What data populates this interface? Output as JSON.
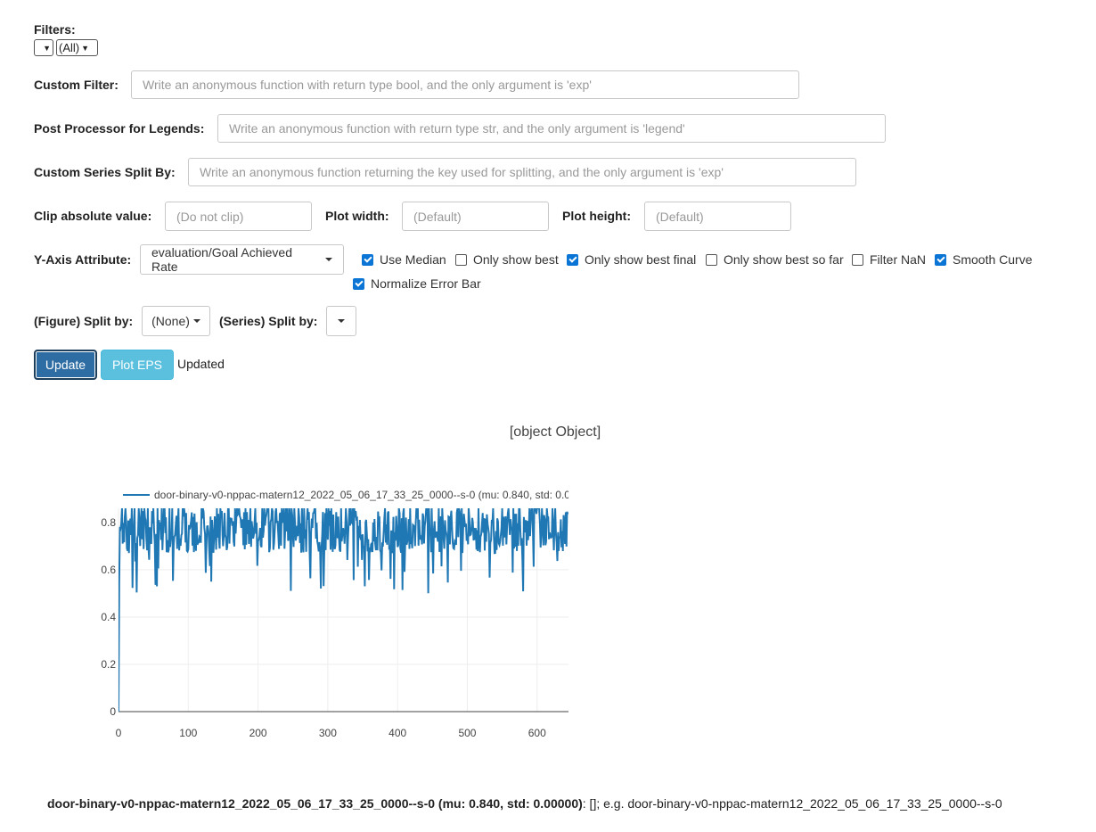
{
  "filters": {
    "label": "Filters:",
    "select1_value": "",
    "select2_value": "(All)"
  },
  "custom_filter": {
    "label": "Custom Filter:",
    "placeholder": "Write an anonymous function with return type bool, and the only argument is 'exp'"
  },
  "post_processor": {
    "label": "Post Processor for Legends:",
    "placeholder": "Write an anonymous function with return type str, and the only argument is 'legend'"
  },
  "series_split_fn": {
    "label": "Custom Series Split By:",
    "placeholder": "Write an anonymous function returning the key used for splitting, and the only argument is 'exp'"
  },
  "clip": {
    "label": "Clip absolute value:",
    "placeholder": "(Do not clip)"
  },
  "plot_width": {
    "label": "Plot width:",
    "placeholder": "(Default)"
  },
  "plot_height": {
    "label": "Plot height:",
    "placeholder": "(Default)"
  },
  "y_axis": {
    "label": "Y-Axis Attribute:",
    "value": "evaluation/Goal Achieved Rate"
  },
  "options": [
    {
      "label": "Use Median",
      "checked": true
    },
    {
      "label": "Only show best",
      "checked": false
    },
    {
      "label": "Only show best final",
      "checked": true
    },
    {
      "label": "Only show best so far",
      "checked": false
    },
    {
      "label": "Filter NaN",
      "checked": false
    },
    {
      "label": "Smooth Curve",
      "checked": true
    },
    {
      "label": "Normalize Error Bar",
      "checked": true
    }
  ],
  "figure_split": {
    "label": "(Figure) Split by:",
    "value": "(None)"
  },
  "series_split": {
    "label": "(Series) Split by:",
    "value": ""
  },
  "buttons": {
    "update": "Update",
    "plot_eps": "Plot EPS",
    "status": "Updated"
  },
  "plot_title": "[object Object]",
  "chart_data": {
    "type": "line",
    "title": "[object Object]",
    "xlabel": "",
    "ylabel": "",
    "xlim": [
      0,
      645
    ],
    "ylim": [
      0,
      0.86
    ],
    "xticks": [
      0,
      100,
      200,
      300,
      400,
      500,
      600
    ],
    "yticks": [
      0,
      0.2,
      0.4,
      0.6,
      0.8
    ],
    "ytick_labels": [
      "0",
      "0.2",
      "0.4",
      "0.6",
      "0.8"
    ],
    "grid": true,
    "legend_position": "top-left",
    "series": [
      {
        "name": "door-binary-v0-nppac-matern12_2022_05_06_17_33_25_0000--s-0 (mu: 0.840, std: 0.00000)",
        "color": "#1f77b4",
        "seed": 42,
        "n_points": 645,
        "x_step": 1,
        "start_values": [
          0.0,
          0.55,
          0.78
        ],
        "range_low": 0.5,
        "range_high": 0.86,
        "typical_value": 0.76
      }
    ]
  },
  "footer": {
    "bold": "door-binary-v0-nppac-matern12_2022_05_06_17_33_25_0000--s-0 (mu: 0.840, std: 0.00000)",
    "rest": ": []; e.g. door-binary-v0-nppac-matern12_2022_05_06_17_33_25_0000--s-0"
  }
}
